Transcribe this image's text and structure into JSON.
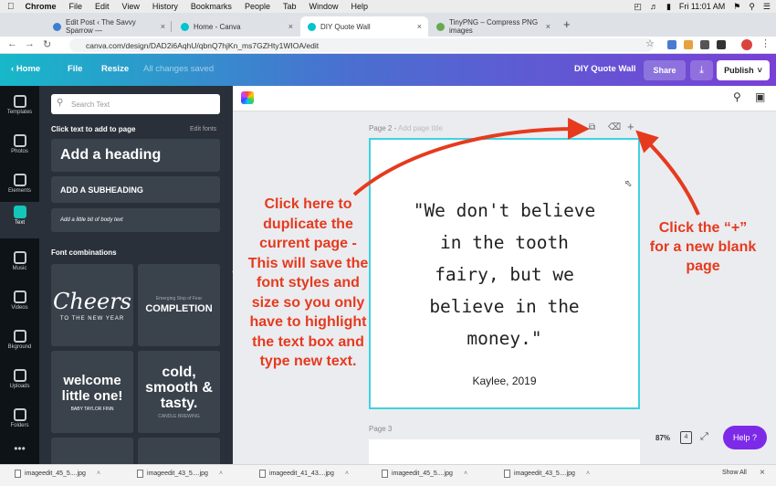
{
  "mac": {
    "app": "Chrome",
    "menus": [
      "File",
      "Edit",
      "View",
      "History",
      "Bookmarks",
      "People",
      "Tab",
      "Window",
      "Help"
    ],
    "clock": "Fri 11:01 AM"
  },
  "tabs": [
    {
      "title": "Edit Post ‹ The Savvy Sparrow —",
      "color": "#3a80d2"
    },
    {
      "title": "Home - Canva",
      "color": "#00c4cc"
    },
    {
      "title": "DIY Quote Wall",
      "color": "#00c4cc"
    },
    {
      "title": "TinyPNG – Compress PNG images",
      "color": "#6aa84f"
    }
  ],
  "url": "canva.com/design/DAD2i6AqhU/qbnQ7hjKn_ms7GZHty1WIOA/edit",
  "header": {
    "home": "Home",
    "file": "File",
    "resize": "Resize",
    "saved": "All changes saved",
    "design_title": "DIY Quote Wall",
    "share": "Share",
    "download_icon": "⤓",
    "publish": "Publish"
  },
  "rail": [
    "Templates",
    "Photos",
    "Elements",
    "Text",
    "Music",
    "Videos",
    "Bkground",
    "Uploads",
    "Folders"
  ],
  "panel": {
    "search_placeholder": "Search Text",
    "click_text": "Click text to add to page",
    "edit_fonts": "Edit fonts",
    "heading": "Add a heading",
    "subheading": "ADD A SUBHEADING",
    "body": "Add a little bit of body text",
    "font_combinations": "Font combinations",
    "combos": [
      {
        "big": "Cheers",
        "small": "TO THE NEW YEAR"
      },
      {
        "small": "Emerging Stop of Fear",
        "big": "COMPLETION"
      },
      {
        "big": "welcome little one!",
        "small": "BABY TAYLOR FINN"
      },
      {
        "big": "cold, smooth & tasty.",
        "small": "CANDLE BREWING"
      }
    ]
  },
  "canvas": {
    "page2_label": "Page 2 -",
    "page2_title_placeholder": "Add page title",
    "page3_label": "Page 3",
    "quote": "\"We don't believe\nin the tooth\nfairy, but we\nbelieve in the\nmoney.\"",
    "author": "Kaylee, 2019",
    "zoom": "87%",
    "help": "Help ?"
  },
  "annotations": {
    "left": "Click here to duplicate the current page - This will save the font styles and size so you only have to highlight the text box and type new text.",
    "right": "Click the “+” for a new blank page"
  },
  "downloads": [
    "imageedit_45_5....jpg",
    "imageedit_43_5....jpg",
    "imageedit_41_43....jpg",
    "imageedit_45_5....jpg",
    "imageedit_43_5....jpg"
  ],
  "show_all": "Show All",
  "colors": {
    "accent": "#7d2ae8",
    "annotation": "#e63a1e",
    "selection": "#3ed2e0"
  }
}
